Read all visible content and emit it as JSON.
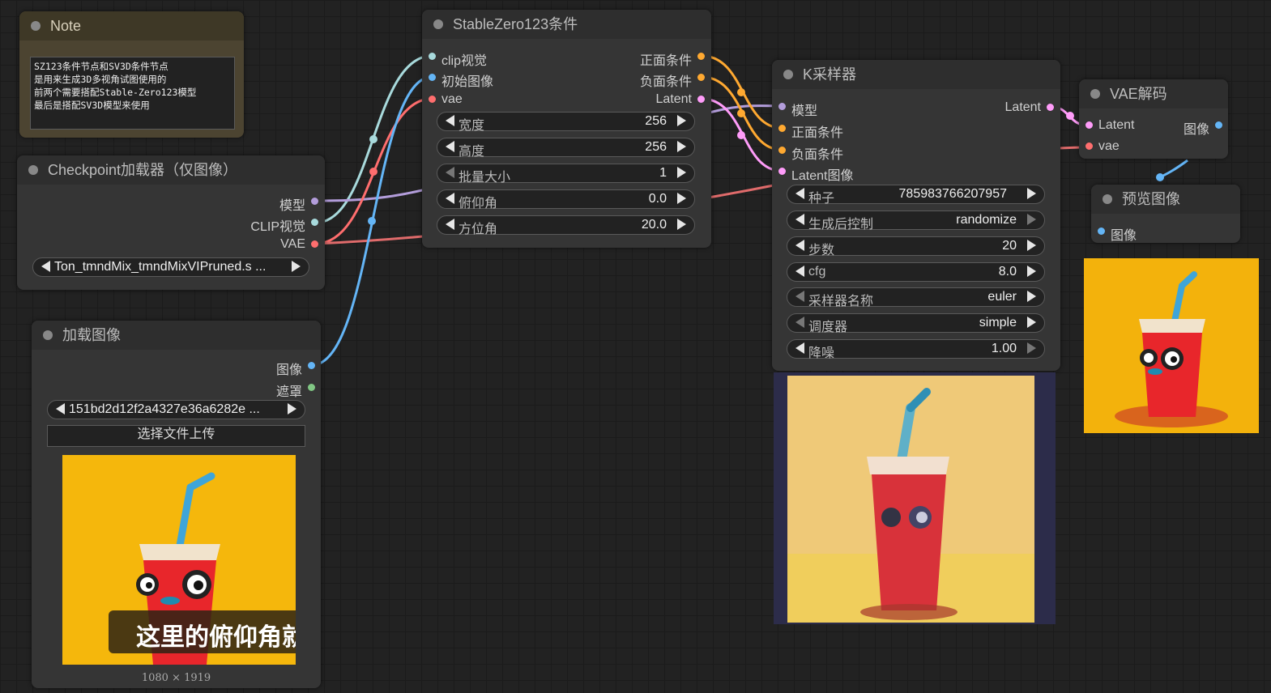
{
  "colors": {
    "clip_vision": "#a8dadc",
    "image": "#64b5f6",
    "vae": "#ff6e6e",
    "conditioning": "#ffa931",
    "latent": "#ff9cf9",
    "model": "#b39ddb",
    "mask": "#81c784"
  },
  "note": {
    "title": "Note",
    "lines": [
      "SZ123条件节点和SV3D条件节点",
      "是用来生成3D多视角试图使用的",
      "前两个需要搭配Stable-Zero123模型",
      "最后是搭配SV3D模型来使用"
    ]
  },
  "checkpoint": {
    "title": "Checkpoint加载器（仅图像）",
    "outputs": [
      "模型",
      "CLIP视觉",
      "VAE"
    ],
    "ckpt_name": "Ton_tmndMix_tmndMixVIPruned.s ..."
  },
  "load_image": {
    "title": "加载图像",
    "outputs": [
      "图像",
      "遮罩"
    ],
    "image_name": "151bd2d12f2a4327e36a6282e ...",
    "upload_label": "选择文件上传",
    "caption": "这里的俯仰角就",
    "dimensions": "1080 × 1919"
  },
  "sz123": {
    "title": "StableZero123条件",
    "inputs": [
      "clip视觉",
      "初始图像",
      "vae"
    ],
    "outputs": [
      "正面条件",
      "负面条件",
      "Latent"
    ],
    "widgets": [
      {
        "label": "宽度",
        "value": "256"
      },
      {
        "label": "高度",
        "value": "256"
      },
      {
        "label": "批量大小",
        "value": "1"
      },
      {
        "label": "俯仰角",
        "value": "0.0"
      },
      {
        "label": "方位角",
        "value": "20.0"
      }
    ]
  },
  "ksampler": {
    "title": "K采样器",
    "inputs": [
      "模型",
      "正面条件",
      "负面条件",
      "Latent图像"
    ],
    "output": "Latent",
    "widgets": [
      {
        "label": "种子",
        "value": "785983766207957"
      },
      {
        "label": "生成后控制",
        "value": "randomize"
      },
      {
        "label": "步数",
        "value": "20"
      },
      {
        "label": "cfg",
        "value": "8.0"
      },
      {
        "label": "采样器名称",
        "value": "euler"
      },
      {
        "label": "调度器",
        "value": "simple"
      },
      {
        "label": "降噪",
        "value": "1.00"
      }
    ]
  },
  "vae_decode": {
    "title": "VAE解码",
    "inputs": [
      "Latent",
      "vae"
    ],
    "output": "图像"
  },
  "preview": {
    "title": "预览图像",
    "input": "图像"
  }
}
